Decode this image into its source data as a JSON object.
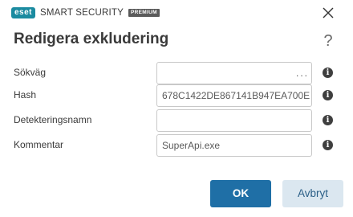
{
  "titlebar": {
    "brand_badge": "eset",
    "brand_name": "SMART SECURITY",
    "brand_tier": "PREMIUM"
  },
  "dialog": {
    "title": "Redigera exkludering",
    "help": "?"
  },
  "form": {
    "path": {
      "label": "Sökväg",
      "value": "",
      "browse": "..."
    },
    "hash": {
      "label": "Hash",
      "value": "678C1422DE867141B947EA700E"
    },
    "detection_name": {
      "label": "Detekteringsnamn",
      "value": ""
    },
    "comment": {
      "label": "Kommentar",
      "value": "SuperApi.exe"
    }
  },
  "buttons": {
    "ok": "OK",
    "cancel": "Avbryt"
  },
  "icons": {
    "close": "close-icon",
    "help": "help-icon",
    "info": "info-icon"
  },
  "colors": {
    "brand": "#1b8ba0",
    "primary_button": "#1f6fa6",
    "secondary_button": "#dbe7f0"
  }
}
